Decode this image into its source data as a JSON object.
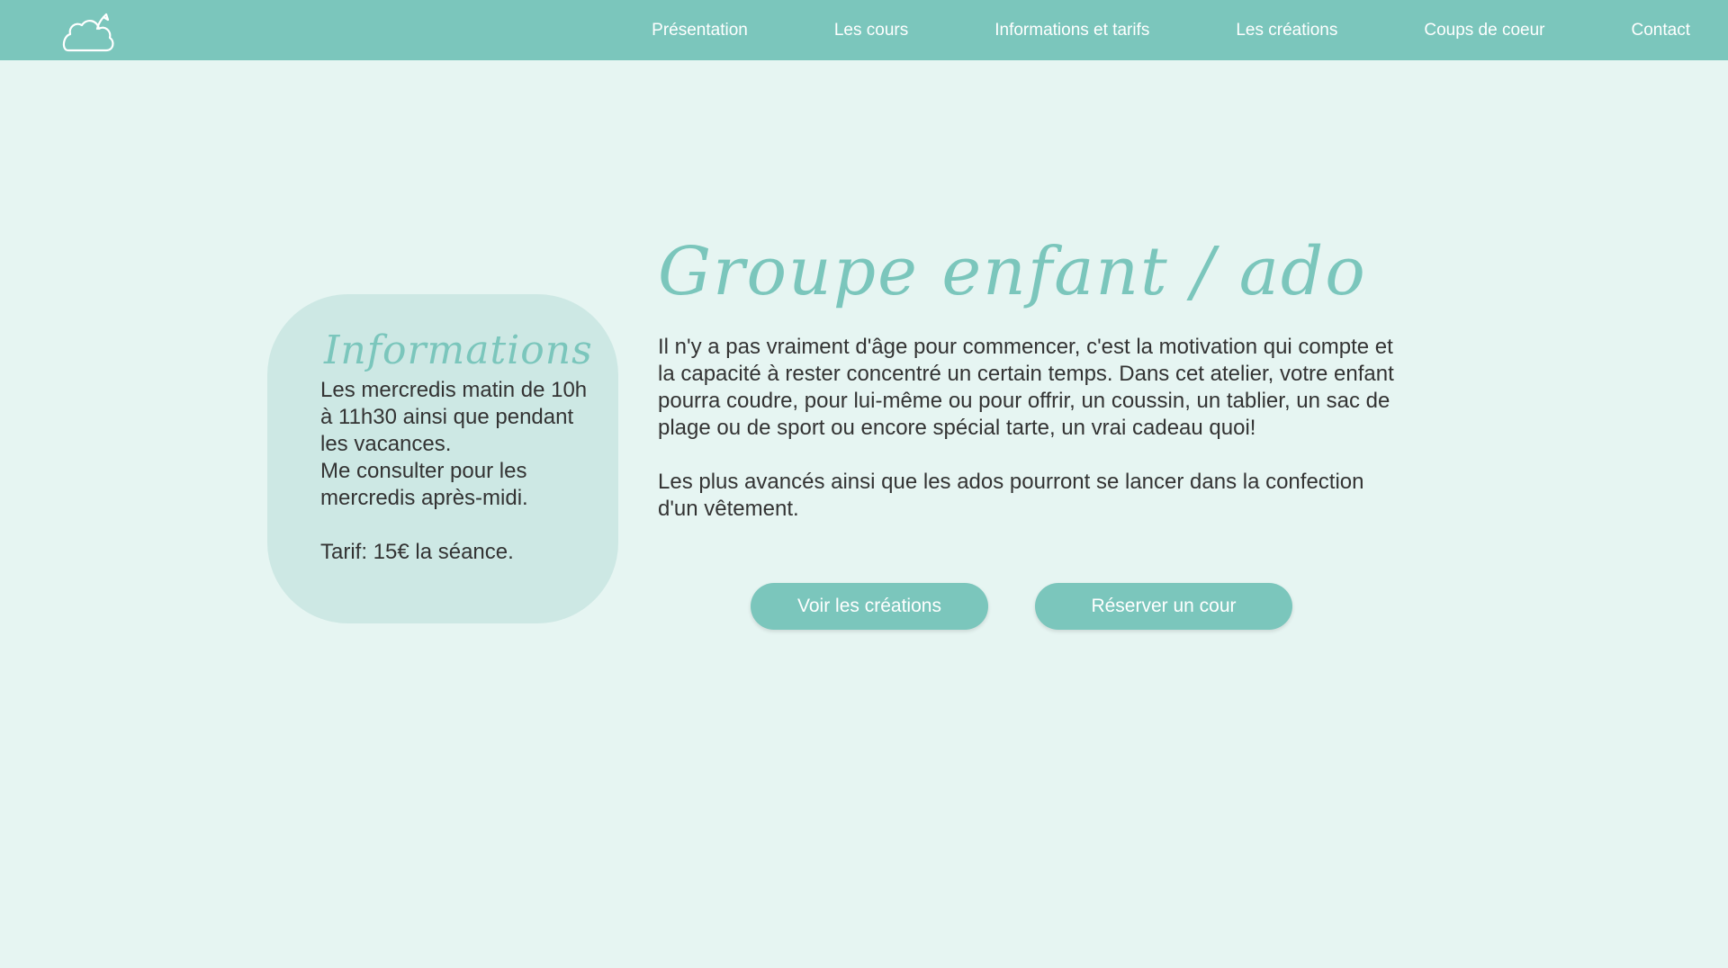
{
  "brand": {
    "logo_icon": "cloud-icon",
    "accent_color": "#7bc6bc",
    "background_color": "#e6f5f2",
    "card_color": "#cde8e4"
  },
  "nav": {
    "items": [
      {
        "label": "Présentation"
      },
      {
        "label": "Les cours"
      },
      {
        "label": "Informations et tarifs"
      },
      {
        "label": "Les créations"
      },
      {
        "label": "Coups de coeur"
      },
      {
        "label": "Contact"
      }
    ]
  },
  "info": {
    "title": "Informations",
    "schedule": "Les mercredis matin de 10h à 11h30 ainsi que pendant les vacances.",
    "note": "Me consulter pour les mercredis après-midi.",
    "price": "Tarif: 15€ la séance."
  },
  "main": {
    "title": "Groupe enfant / ado",
    "paragraph_1": "Il n'y a pas vraiment d'âge pour commencer, c'est la motivation qui compte et la capacité à rester concentré un certain temps. Dans cet atelier, votre enfant pourra coudre, pour lui-même ou pour offrir, un coussin, un tablier, un sac de plage ou de sport ou encore spécial tarte, un vrai cadeau quoi!",
    "paragraph_2": "Les plus avancés ainsi que les ados pourront se lancer dans la confection d'un vêtement."
  },
  "buttons": {
    "creations_label": "Voir les créations",
    "reserve_label": "Réserver un cour"
  }
}
